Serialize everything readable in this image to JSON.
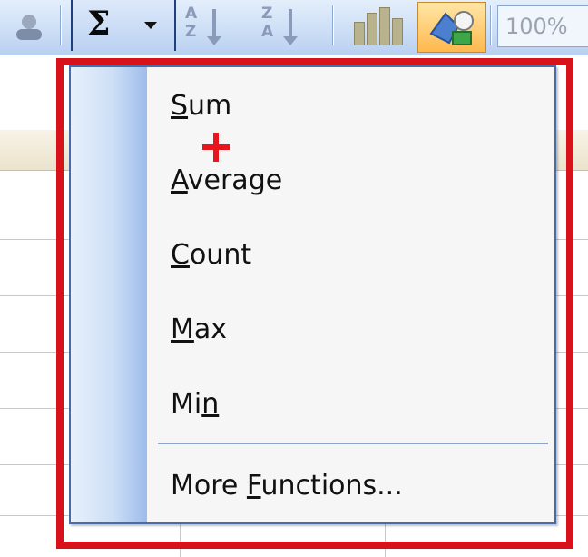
{
  "toolbar": {
    "autosum_button": {
      "icon": "sigma-icon",
      "glyph": "Σ",
      "dropdown_icon": "dropdown-arrow-icon"
    },
    "sort_ascending": {
      "icon": "sort-ascending-icon",
      "letters_top": "A",
      "letters_bottom": "Z"
    },
    "sort_descending": {
      "icon": "sort-descending-icon",
      "letters_top": "Z",
      "letters_bottom": "A"
    },
    "chart_wizard": {
      "icon": "chart-wizard-icon"
    },
    "drawing_button": {
      "icon": "drawing-icon"
    },
    "zoom": {
      "value": "100%"
    }
  },
  "autosum_menu": {
    "items": [
      {
        "pre": "",
        "mnemonic": "S",
        "post": "um"
      },
      {
        "pre": "",
        "mnemonic": "A",
        "post": "verage"
      },
      {
        "pre": "",
        "mnemonic": "C",
        "post": "ount"
      },
      {
        "pre": "",
        "mnemonic": "M",
        "post": "ax"
      },
      {
        "pre": "Mi",
        "mnemonic": "n",
        "post": ""
      },
      {
        "pre": "More ",
        "mnemonic": "F",
        "post": "unctions..."
      }
    ]
  },
  "colors": {
    "highlight_frame": "#d8121b",
    "cursor_mark": "#e8141e",
    "menu_border": "#4a6aa8",
    "toolbar_gradient_top": "#e4eefb"
  }
}
